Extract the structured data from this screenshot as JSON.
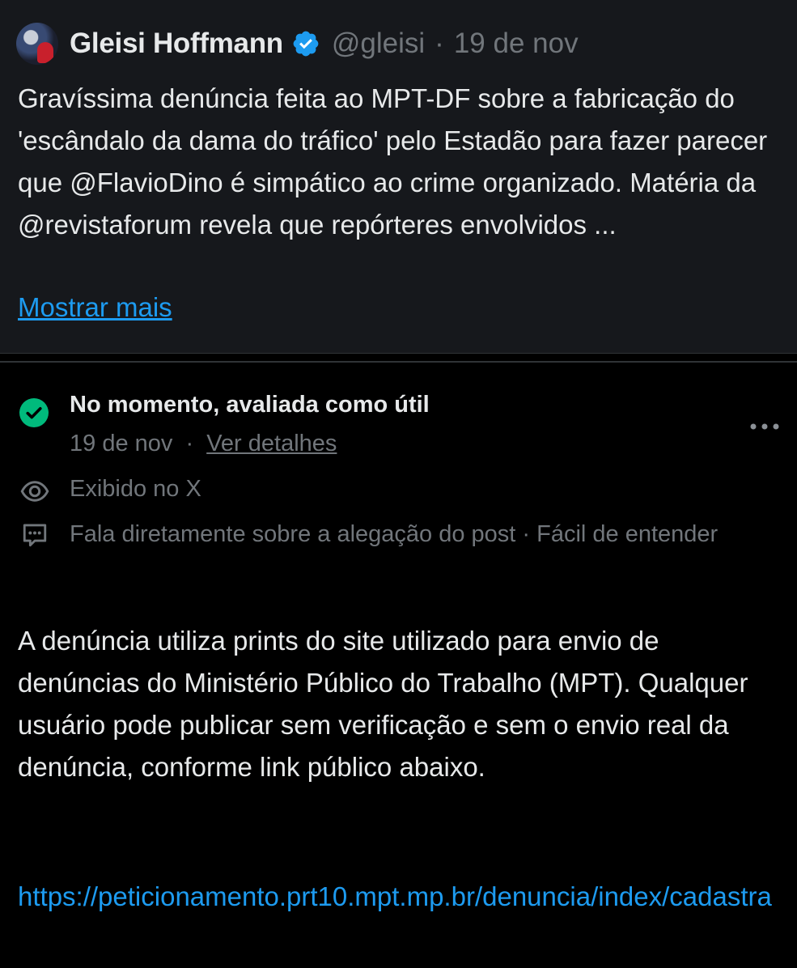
{
  "post": {
    "author_name": "Gleisi Hoffmann",
    "handle": "@gleisi",
    "separator": "·",
    "date": "19 de nov",
    "text": "Gravíssima denúncia feita ao MPT-DF sobre a fabricação do 'escândalo da dama do tráfico' pelo Estadão para fazer parecer que @FlavioDino é simpático ao crime organizado. Matéria da @revistaforum revela que repórteres envolvidos ...",
    "show_more": "Mostrar mais"
  },
  "note": {
    "status": "No momento, avaliada como útil",
    "date": "19 de nov",
    "separator": "·",
    "details_link": "Ver detalhes",
    "shown_on": "Exibido no X",
    "criteria": "Fala diretamente sobre a alegação do post · Fácil de entender",
    "body": "A denúncia utiliza prints do site utilizado para envio de denúncias do Ministério Público do Trabalho (MPT). Qualquer usuário pode publicar sem verificação e sem o envio real da denúncia, conforme link público abaixo.",
    "link": "https://peticionamento.prt10.mpt.mp.br/denuncia/index/cadastra"
  },
  "icons": {
    "verified": "verified-badge-icon",
    "status": "check-circle-icon",
    "more": "more-options-icon",
    "eye": "eye-icon",
    "message": "message-icon"
  },
  "colors": {
    "background": "#000000",
    "card": "#16181c",
    "text": "#e7e9ea",
    "muted": "#71767b",
    "accent_blue": "#1d9bf0",
    "success_green": "#00ba7c"
  }
}
